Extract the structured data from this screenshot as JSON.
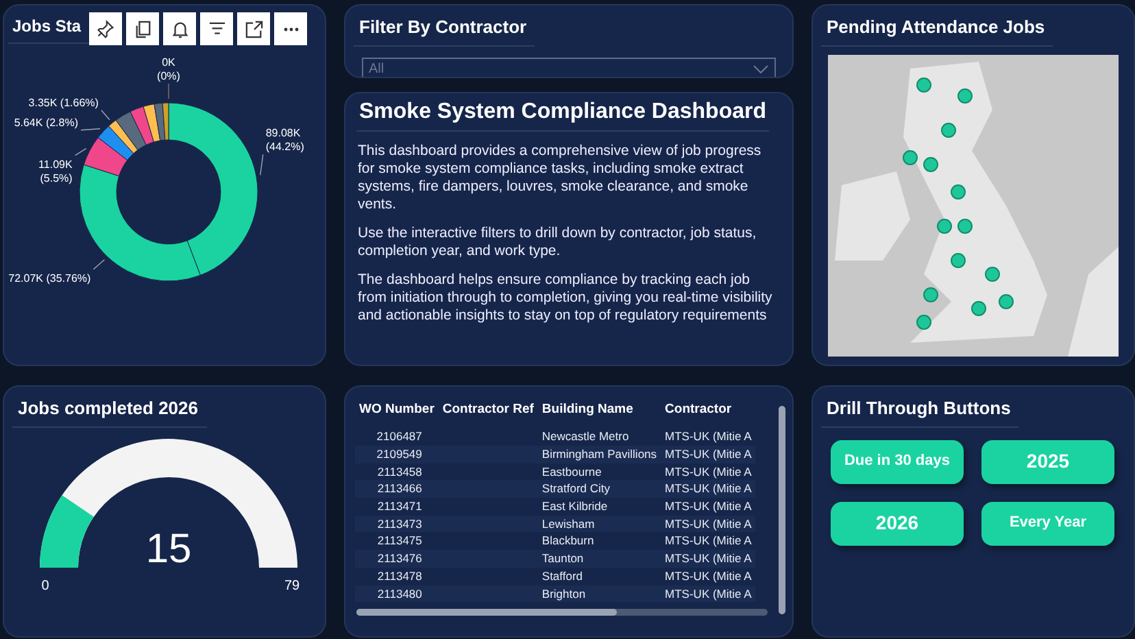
{
  "jobs_status": {
    "title": "Jobs Sta",
    "chart_data": {
      "type": "donut",
      "values": [
        44.2,
        35.76,
        5.5,
        2.8,
        1.66,
        3.0,
        2.5,
        2.0,
        1.5,
        1.08,
        0
      ],
      "colors": [
        "#1ad3a1",
        "#1ad3a1",
        "#f0478a",
        "#1f8ef1",
        "#ffbe4f",
        "#5a6a7e",
        "#f0478a",
        "#ffbe4f",
        "#5a6a7e",
        "#c9a227",
        "#8d6e63"
      ],
      "value_labels": [
        "89.08K\n(44.2%)",
        "72.07K (35.76%)",
        "11.09K\n(5.5%)",
        "5.64K (2.8%)",
        "3.35K (1.66%)",
        null,
        null,
        null,
        null,
        null,
        "0K\n(0%)"
      ],
      "data_labels": true
    }
  },
  "filter": {
    "title": "Filter By Contractor",
    "value": "All"
  },
  "description": {
    "title": "Smoke System Compliance Dashboard",
    "paragraphs": [
      "This dashboard provides a comprehensive view of job progress for smoke system compliance tasks, including smoke extract systems, fire dampers, louvres, smoke clearance, and smoke vents.",
      "Use the interactive filters to drill down by contractor, job status, completion year, and work type.",
      "The dashboard helps ensure compliance by tracking each job from initiation through to completion, giving you real-time visibility and actionable insights to stay on top of regulatory requirements"
    ]
  },
  "map": {
    "title": "Pending Attendance Jobs",
    "kind": "picture"
  },
  "gauge": {
    "title": "Jobs completed 2026",
    "value": "15",
    "min": "0",
    "max": "79",
    "level": 0.19
  },
  "table": {
    "columns": [
      "WO Number",
      "Contractor Ref",
      "Building Name",
      "Contractor"
    ],
    "rows": [
      [
        "2106487",
        "",
        "Newcastle Metro",
        "MTS-UK (Mitie A"
      ],
      [
        "2109549",
        "",
        "Birmingham Pavillions",
        "MTS-UK (Mitie A"
      ],
      [
        "2113458",
        "",
        "Eastbourne",
        "MTS-UK (Mitie A"
      ],
      [
        "2113466",
        "",
        "Stratford City",
        "MTS-UK (Mitie A"
      ],
      [
        "2113471",
        "",
        "East Kilbride",
        "MTS-UK (Mitie A"
      ],
      [
        "2113473",
        "",
        "Lewisham",
        "MTS-UK (Mitie A"
      ],
      [
        "2113475",
        "",
        "Blackburn",
        "MTS-UK (Mitie A"
      ],
      [
        "2113476",
        "",
        "Taunton",
        "MTS-UK (Mitie A"
      ],
      [
        "2113478",
        "",
        "Stafford",
        "MTS-UK (Mitie A"
      ],
      [
        "2113480",
        "",
        "Brighton",
        "MTS-UK (Mitie A"
      ]
    ]
  },
  "drill": {
    "title": "Drill Through Buttons",
    "buttons": [
      "Due in 30 days",
      "2025",
      "2026",
      "Every Year"
    ]
  }
}
